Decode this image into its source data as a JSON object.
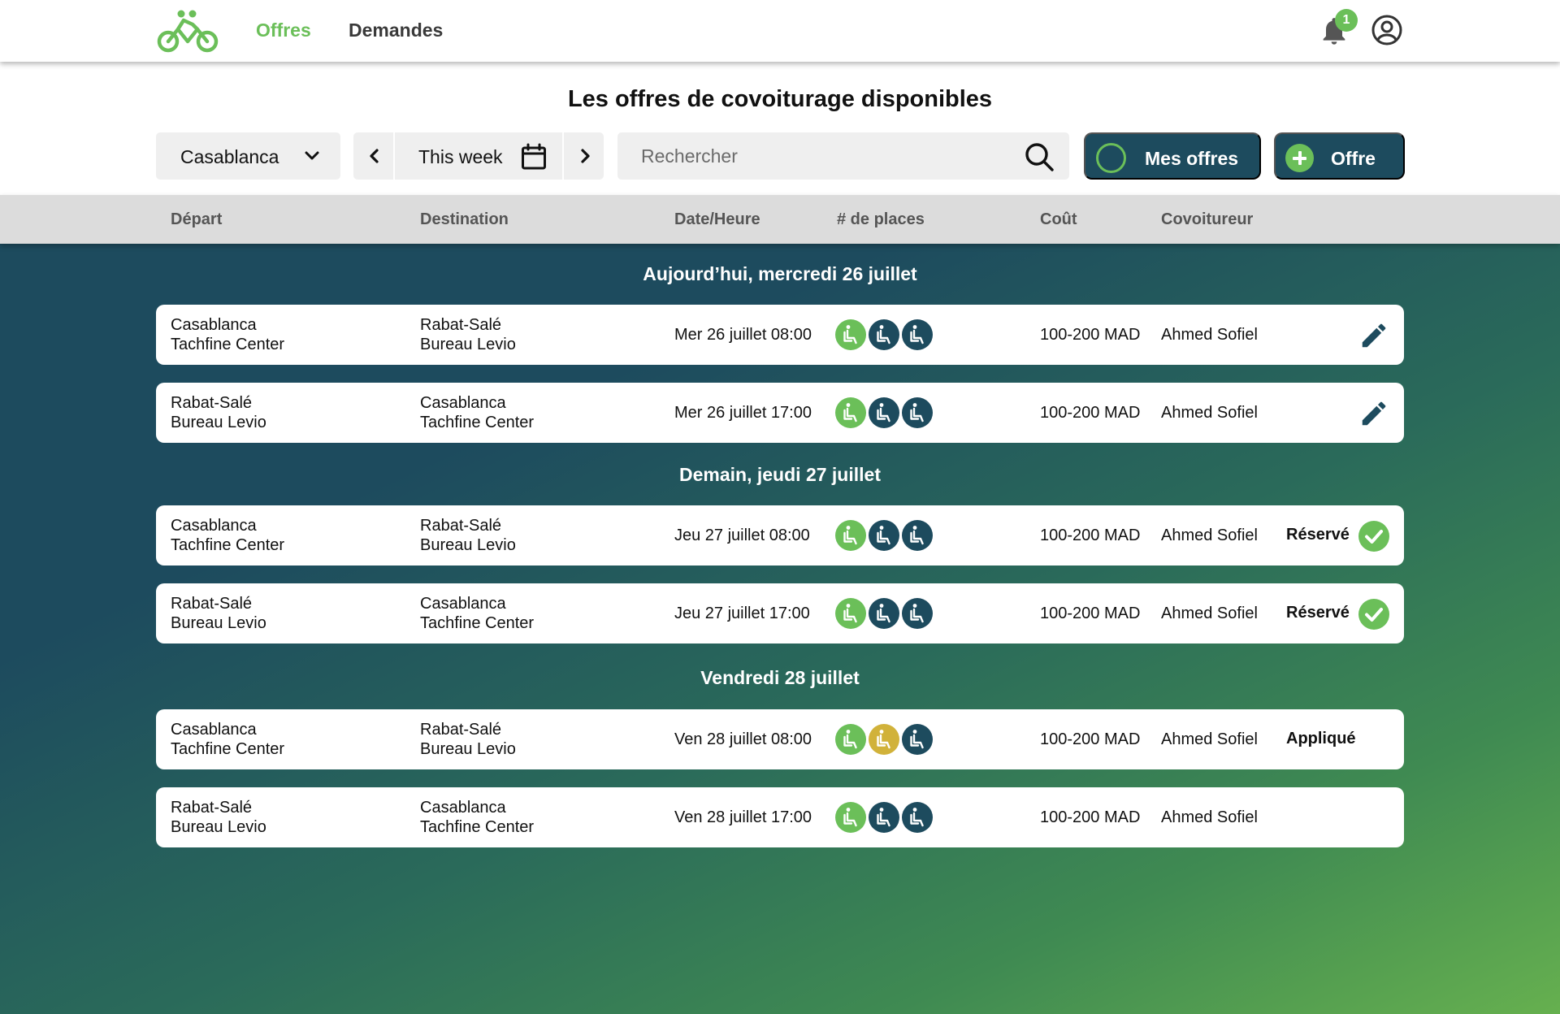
{
  "colors": {
    "brand_green": "#6bbf59",
    "dark_teal": "#1d4b5e",
    "seat_taken": "#1d4b5e",
    "seat_free": "#6bbf59",
    "seat_pending": "#d1b23a"
  },
  "nav": {
    "logo_icon": "bike-pair-icon",
    "offres_label": "Offres",
    "demandes_label": "Demandes",
    "notification_count": "1",
    "bell_icon": "bell-icon",
    "account_icon": "account-circle-icon"
  },
  "header": {
    "title": "Les offres de covoiturage disponibles",
    "city": "Casablanca",
    "week": "This week",
    "search_placeholder": "Rechercher",
    "mes_offres_label": "Mes offres",
    "offre_label": "Offre"
  },
  "columns": {
    "depart": "Départ",
    "destination": "Destination",
    "date": "Date/Heure",
    "places": "# de places",
    "cout": "Coût",
    "covoitureur": "Covoitureur"
  },
  "groups": [
    {
      "title": "Aujourd’hui, mercredi 26 juillet",
      "rows": [
        {
          "dep1": "Casablanca",
          "dep2": "Tachfine Center",
          "dest1": "Rabat-Salé",
          "dest2": "Bureau Levio",
          "date": "Mer 26 juillet 08:00",
          "seats": [
            "free",
            "taken",
            "taken"
          ],
          "cost": "100-200 MAD",
          "driver": "Ahmed Sofiel",
          "status": "",
          "action": "edit"
        },
        {
          "dep1": "Rabat-Salé",
          "dep2": "Bureau Levio",
          "dest1": "Casablanca",
          "dest2": "Tachfine Center",
          "date": "Mer 26 juillet 17:00",
          "seats": [
            "free",
            "taken",
            "taken"
          ],
          "cost": "100-200 MAD",
          "driver": "Ahmed Sofiel",
          "status": "",
          "action": "edit"
        }
      ]
    },
    {
      "title": "Demain, jeudi 27 juillet",
      "rows": [
        {
          "dep1": "Casablanca",
          "dep2": "Tachfine Center",
          "dest1": "Rabat-Salé",
          "dest2": "Bureau Levio",
          "date": "Jeu 27 juillet 08:00",
          "seats": [
            "free",
            "taken",
            "taken"
          ],
          "cost": "100-200 MAD",
          "driver": "Ahmed Sofiel",
          "status": "Réservé",
          "action": "check"
        },
        {
          "dep1": "Rabat-Salé",
          "dep2": "Bureau Levio",
          "dest1": "Casablanca",
          "dest2": "Tachfine Center",
          "date": "Jeu 27 juillet 17:00",
          "seats": [
            "free",
            "taken",
            "taken"
          ],
          "cost": "100-200 MAD",
          "driver": "Ahmed Sofiel",
          "status": "Réservé",
          "action": "check"
        }
      ]
    },
    {
      "title": "Vendredi 28 juillet",
      "rows": [
        {
          "dep1": "Casablanca",
          "dep2": "Tachfine Center",
          "dest1": "Rabat-Salé",
          "dest2": "Bureau Levio",
          "date": "Ven 28 juillet 08:00",
          "seats": [
            "free",
            "pending",
            "taken"
          ],
          "cost": "100-200 MAD",
          "driver": "Ahmed Sofiel",
          "status": "Appliqué",
          "action": ""
        },
        {
          "dep1": "Rabat-Salé",
          "dep2": "Bureau Levio",
          "dest1": "Casablanca",
          "dest2": "Tachfine Center",
          "date": "Ven 28 juillet 17:00",
          "seats": [
            "free",
            "taken",
            "taken"
          ],
          "cost": "100-200 MAD",
          "driver": "Ahmed Sofiel",
          "status": "",
          "action": ""
        }
      ]
    }
  ]
}
